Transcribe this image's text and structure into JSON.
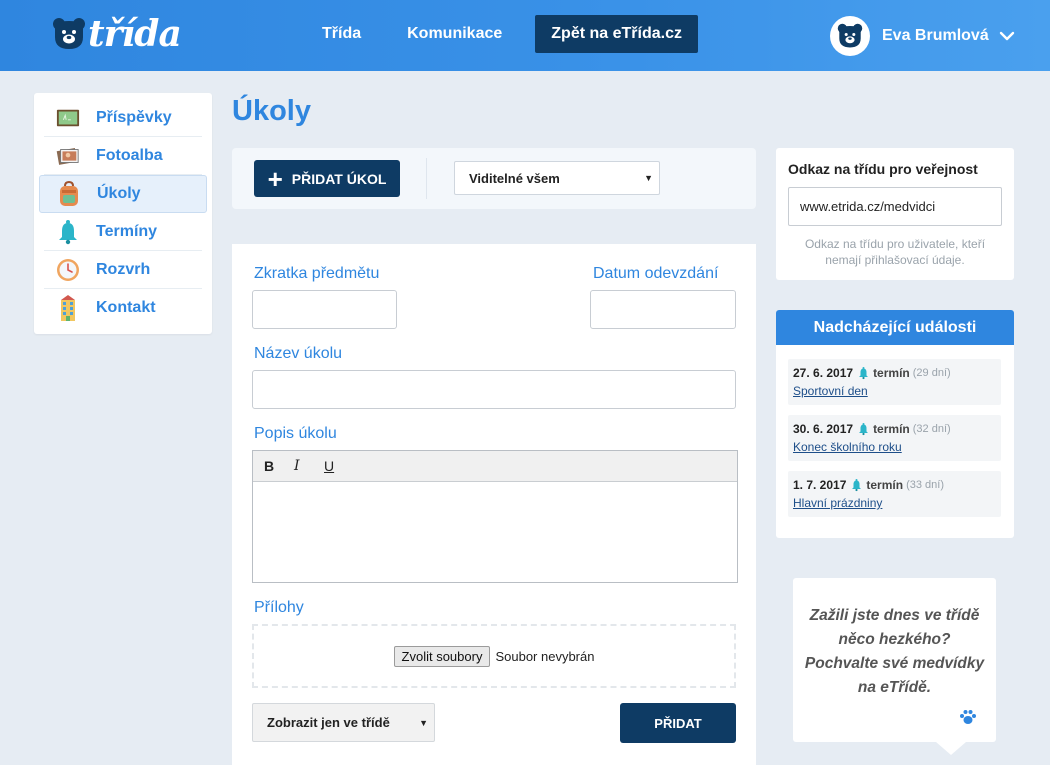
{
  "header": {
    "logo_text": "třída",
    "nav": [
      {
        "label": "Třída"
      },
      {
        "label": "Komunikace"
      }
    ],
    "back_button": "Zpět na eTřída.cz",
    "user_name": "Eva Brumlová"
  },
  "sidebar": {
    "items": [
      {
        "label": "Příspěvky",
        "icon": "chalkboard-icon"
      },
      {
        "label": "Fotoalba",
        "icon": "photo-album-icon"
      },
      {
        "label": "Úkoly",
        "icon": "backpack-icon",
        "active": true
      },
      {
        "label": "Termíny",
        "icon": "bell-icon"
      },
      {
        "label": "Rozvrh",
        "icon": "clock-icon"
      },
      {
        "label": "Kontakt",
        "icon": "building-icon"
      }
    ]
  },
  "main": {
    "title": "Úkoly",
    "toolbar": {
      "add_label": "PŘIDAT ÚKOL",
      "visibility_selected": "Viditelné všem"
    },
    "form": {
      "subject_label": "Zkratka předmětu",
      "subject_value": "",
      "due_label": "Datum odevzdání",
      "due_value": "",
      "name_label": "Název úkolu",
      "name_value": "",
      "description_label": "Popis úkolu",
      "format": {
        "bold": "B",
        "italic": "I",
        "underline": "U"
      },
      "attachments_label": "Přílohy",
      "file_button": "Zvolit soubory",
      "file_status": "Soubor nevybrán",
      "show_selected": "Zobrazit jen ve třídě",
      "submit_label": "PŘIDAT"
    }
  },
  "right": {
    "public_link": {
      "title": "Odkaz na třídu pro veřejnost",
      "url": "www.etrida.cz/medvidci",
      "note": "Odkaz na třídu pro uživatele, kteří nemají přihlašovací údaje."
    },
    "events": {
      "title": "Nadcházející události",
      "items": [
        {
          "date": "27. 6. 2017",
          "type": "termín",
          "days": "(29 dní)",
          "name": "Sportovní den"
        },
        {
          "date": "30. 6. 2017",
          "type": "termín",
          "days": "(32 dní)",
          "name": "Konec školního roku"
        },
        {
          "date": "1. 7. 2017",
          "type": "termín",
          "days": "(33 dní)",
          "name": "Hlavní prázdniny"
        }
      ]
    },
    "promo": "Zažili jste dnes ve třídě něco hezkého? Pochvalte své medvídky na eTřídě."
  },
  "colors": {
    "brand_blue": "#2f86df",
    "navy": "#0e3b64",
    "background": "#e6ecf3"
  }
}
